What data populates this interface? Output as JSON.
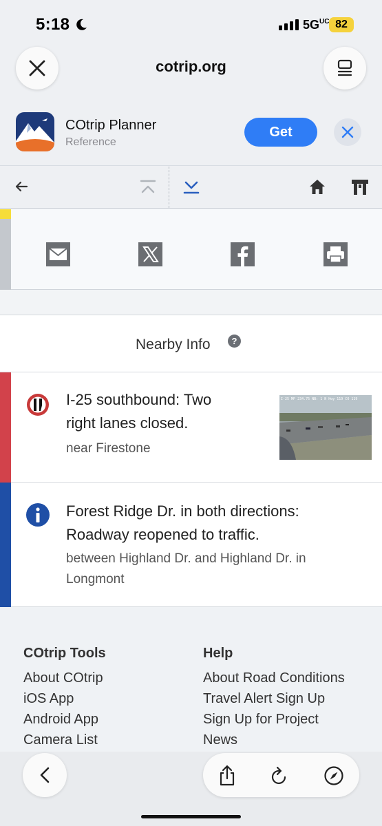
{
  "status_bar": {
    "time": "5:18",
    "network": "5G",
    "network_suffix": "UC",
    "battery": "82"
  },
  "browser": {
    "url": "cotrip.org"
  },
  "app_banner": {
    "name": "COtrip Planner",
    "category": "Reference",
    "get_label": "Get"
  },
  "nearby": {
    "title": "Nearby Info",
    "help_glyph": "?"
  },
  "items": [
    {
      "title_line1": "I-25 southbound: Two",
      "title_line2": "right lanes closed.",
      "location": "near Firestone",
      "strip_color": "#d2424b",
      "icon": "lane-closure-icon",
      "camera_caption": "I-25 MP 234.75 NB: 1 N Hwy 119 CO 119"
    },
    {
      "title_line1": "Forest Ridge Dr. in both directions:",
      "title_line2": "Roadway reopened to traffic.",
      "location_line1": "between Highland Dr. and Highland Dr. in",
      "location_line2": "Longmont",
      "strip_color": "#1f4fa6",
      "icon": "info-icon"
    }
  ],
  "footer": {
    "tools": {
      "heading": "COtrip Tools",
      "links": [
        "About COtrip",
        "iOS App",
        "Android App",
        "Camera List"
      ]
    },
    "help": {
      "heading": "Help",
      "links": [
        "About Road Conditions",
        "Travel Alert Sign Up",
        "Sign Up for Project",
        "News"
      ]
    }
  },
  "colors": {
    "accent": "#2f7df6",
    "link_blue": "#2a5fbf",
    "closure_red": "#d2424b",
    "info_blue": "#1f4fa6"
  }
}
